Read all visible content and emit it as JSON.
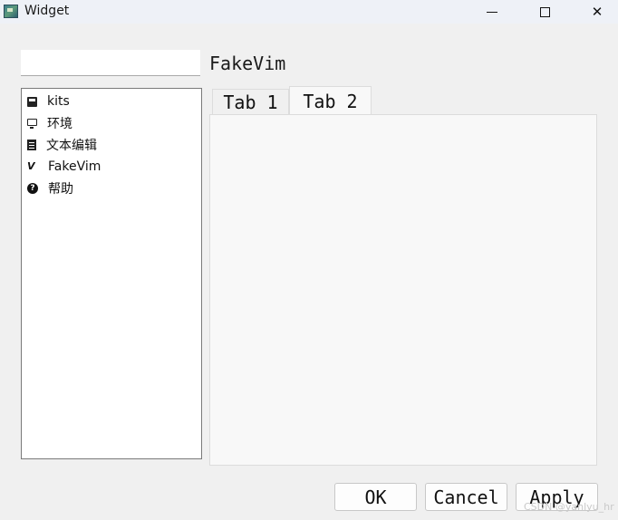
{
  "window": {
    "title": "Widget",
    "minimize_icon": "minimize-icon",
    "maximize_icon": "maximize-icon",
    "close_glyph": "✕"
  },
  "filter": {
    "value": "",
    "placeholder": ""
  },
  "page_title": "FakeVim",
  "sidebar": {
    "items": [
      {
        "label": "kits",
        "icon": "kits-icon"
      },
      {
        "label": "环境",
        "icon": "monitor-icon"
      },
      {
        "label": "文本编辑",
        "icon": "document-icon"
      },
      {
        "label": "FakeVim",
        "icon": "vim-icon",
        "glyph": "V"
      },
      {
        "label": "帮助",
        "icon": "help-icon",
        "glyph": "?"
      }
    ]
  },
  "tabs": [
    {
      "label": "Tab 1",
      "selected": false
    },
    {
      "label": "Tab 2",
      "selected": true
    }
  ],
  "buttons": {
    "ok": "OK",
    "cancel": "Cancel",
    "apply": "Apply"
  },
  "watermark": "CSDN @yanlyu_hr"
}
